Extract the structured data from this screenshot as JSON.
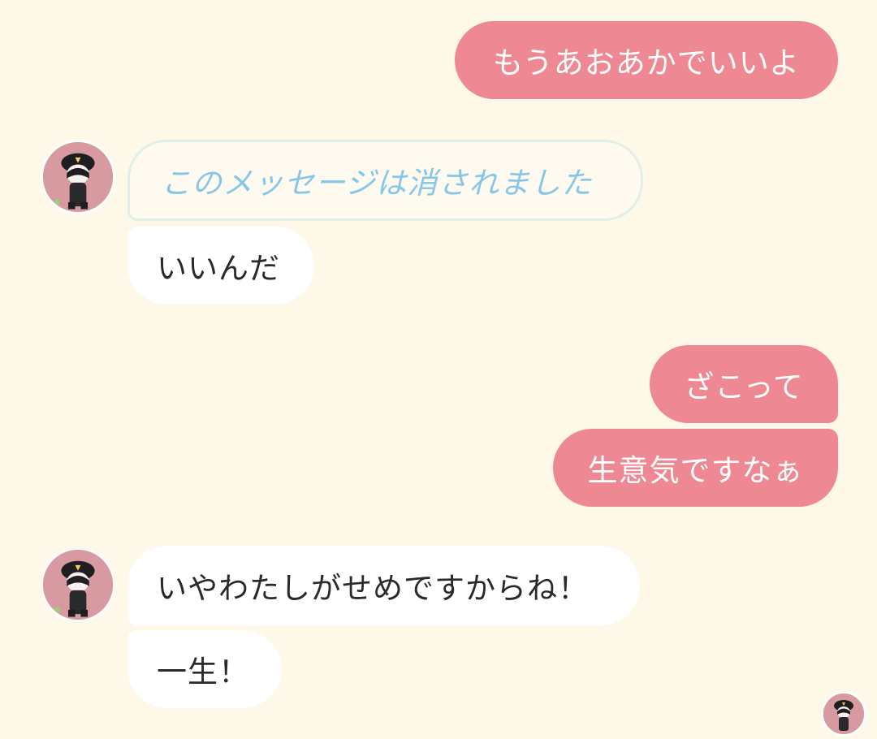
{
  "messages": {
    "out_1": "もうあおあかでいいよ",
    "deleted_notice": "このメッセージは消されました",
    "in_1": "いいんだ",
    "out_2": "ざこって",
    "out_3": "生意気ですなぁ",
    "in_2": "いやわたしがせめですからね！",
    "in_3": "一生！"
  },
  "colors": {
    "background": "#fef8e9",
    "outgoing_bubble": "#ee8892",
    "incoming_bubble": "#ffffff",
    "deleted_text": "#86c6e6",
    "avatar_bg": "#d79aa0"
  },
  "icons": {
    "contact_avatar": "avatar-icon",
    "read_receipt_avatar": "avatar-icon"
  }
}
